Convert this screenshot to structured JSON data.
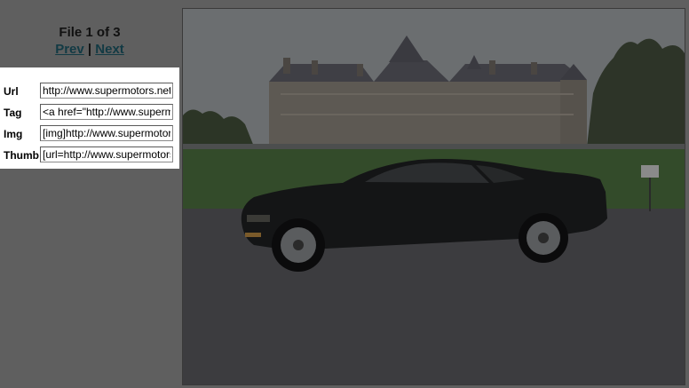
{
  "nav": {
    "file_count": "File 1 of 3",
    "prev_label": "Prev",
    "separator": "|",
    "next_label": "Next"
  },
  "links": [
    {
      "label": "Url",
      "value": "http://www.supermotors.net"
    },
    {
      "label": "Tag",
      "value": "<a href=\"http://www.supermo"
    },
    {
      "label": "Img",
      "value": "[img]http://www.supermotors"
    },
    {
      "label": "Thumb",
      "value": "[url=http://www.supermotors"
    }
  ],
  "photo": {
    "subject": "black coupe in front of a chateau",
    "colors": {
      "sky": "#6b6e70",
      "lawn": "#334b2a",
      "road": "#3c3c3f",
      "car": "#141516"
    }
  }
}
